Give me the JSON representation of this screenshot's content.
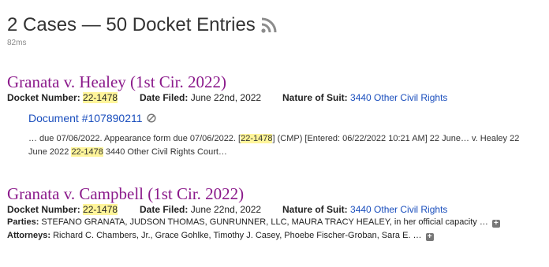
{
  "header": {
    "title": "2 Cases — 50 Docket Entries",
    "timing": "82ms",
    "rss_icon": "rss-icon"
  },
  "labels": {
    "docket_number": "Docket Number:",
    "date_filed": "Date Filed:",
    "nature_of_suit": "Nature of Suit:",
    "parties": "Parties:",
    "attorneys": "Attorneys:"
  },
  "cases": [
    {
      "title": "Granata v. Healey (1st Cir. 2022)",
      "docket_number": "22-1478",
      "date_filed": "June 22nd, 2022",
      "nature_of_suit": "3440 Other Civil Rights",
      "document": {
        "link": "Document #107890211",
        "snippet_1": "… due 07/06/2022. Appearance form due 07/06/2022. [",
        "snippet_hl_1": "22-1478",
        "snippet_2": "] (CMP) [Entered: 06/22/2022 10:21 AM] 22 June… v. Healey 22 June 2022 ",
        "snippet_hl_2": "22-1478",
        "snippet_3": " 3440 Other Civil Rights Court…"
      }
    },
    {
      "title": "Granata v. Campbell (1st Cir. 2022)",
      "docket_number": "22-1478",
      "date_filed": "June 22nd, 2022",
      "nature_of_suit": "3440 Other Civil Rights",
      "parties": "STEFANO GRANATA, JUDSON THOMAS, GUNRUNNER, LLC, MAURA TRACY HEALEY, in her official capacity …",
      "attorneys": "Richard C. Chambers, Jr., Grace Gohlke, Timothy J. Casey, Phoebe Fischer-Groban, Sara E. …"
    }
  ],
  "colors": {
    "case_title": "#8b1a8b",
    "link": "#1a4ebd",
    "highlight": "#fff59a"
  }
}
